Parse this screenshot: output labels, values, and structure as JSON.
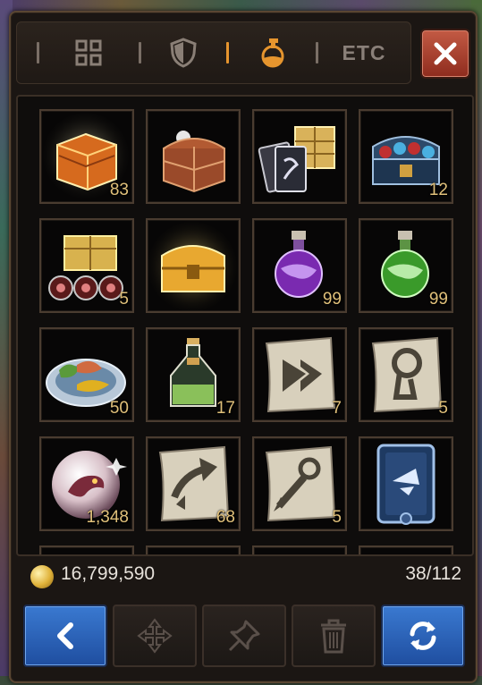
{
  "tabs": [
    {
      "name": "all",
      "icon": "grid-icon",
      "active": false
    },
    {
      "name": "equipment",
      "icon": "shield-icon",
      "active": false
    },
    {
      "name": "consumables",
      "icon": "potion-icon",
      "active": true
    },
    {
      "name": "etc",
      "label": "ETC",
      "active": false
    }
  ],
  "items": [
    {
      "icon": "orange-chest-icon",
      "qty": "83"
    },
    {
      "icon": "glowing-chest-icon",
      "qty": ""
    },
    {
      "icon": "card-chest-icon",
      "qty": ""
    },
    {
      "icon": "gem-chest-icon",
      "qty": "12"
    },
    {
      "icon": "gold-chest-orbs-icon",
      "qty": "5"
    },
    {
      "icon": "golden-treasure-chest-icon",
      "qty": ""
    },
    {
      "icon": "purple-potion-icon",
      "qty": "99"
    },
    {
      "icon": "green-potion-icon",
      "qty": "99"
    },
    {
      "icon": "food-platter-icon",
      "qty": "50"
    },
    {
      "icon": "small-green-potion-icon",
      "qty": "17"
    },
    {
      "icon": "scroll-arrow-icon",
      "qty": "7"
    },
    {
      "icon": "scroll-rune-icon",
      "qty": "5"
    },
    {
      "icon": "dragon-orb-icon",
      "qty": "1,348"
    },
    {
      "icon": "scroll-curve-arrow-icon",
      "qty": "68"
    },
    {
      "icon": "scroll-target-icon",
      "qty": "5"
    },
    {
      "icon": "blue-card-icon",
      "qty": ""
    }
  ],
  "footer": {
    "gold": "16,799,590",
    "slots": "38/112"
  },
  "toolbar": [
    {
      "name": "back-button",
      "icon": "chevron-left-icon"
    },
    {
      "name": "move-button",
      "icon": "move-arrows-icon"
    },
    {
      "name": "pin-button",
      "icon": "pin-icon"
    },
    {
      "name": "trash-button",
      "icon": "trash-icon"
    },
    {
      "name": "sort-button",
      "icon": "refresh-icon"
    }
  ],
  "colors": {
    "accent_tab": "#e6952e",
    "close_button": "#b0412e",
    "blue_button": "#2f66bd",
    "quantity_text": "#e0c07a"
  }
}
